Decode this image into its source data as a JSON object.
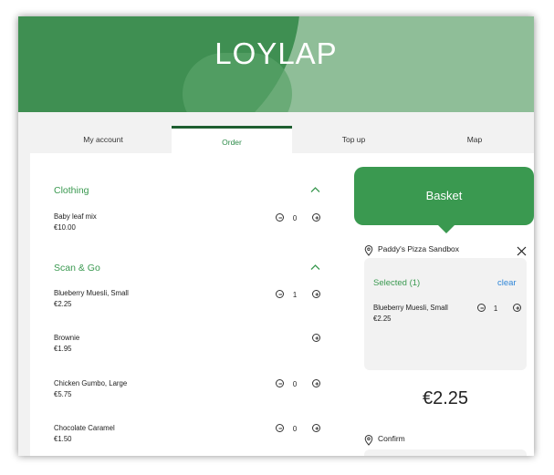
{
  "brand": {
    "title": "LOYLAP"
  },
  "tabs": [
    {
      "label": "My account"
    },
    {
      "label": "Order"
    },
    {
      "label": "Top up"
    },
    {
      "label": "Map"
    }
  ],
  "menu": {
    "categories": [
      {
        "title": "Clothing",
        "items": [
          {
            "name": "Baby leaf mix",
            "price": "€10.00",
            "qty": "0"
          }
        ]
      },
      {
        "title": "Scan & Go",
        "items": [
          {
            "name": "Blueberry Muesli, Small",
            "price": "€2.25",
            "qty": "1"
          },
          {
            "name": "Brownie",
            "price": "€1.95",
            "qty": ""
          },
          {
            "name": "Chicken Gumbo, Large",
            "price": "€5.75",
            "qty": "0"
          },
          {
            "name": "Chocolate Caramel",
            "price": "€1.50",
            "qty": "0"
          }
        ]
      }
    ]
  },
  "basket": {
    "title": "Basket",
    "store": "Paddy's Pizza Sandbox",
    "selected_label": "Selected (1)",
    "clear_label": "clear",
    "items": [
      {
        "name": "Blueberry Muesli, Small",
        "price": "€2.25",
        "qty": "1"
      }
    ],
    "total": "€2.25",
    "confirm_label": "Confirm"
  },
  "colors": {
    "accent": "#3a9950",
    "link": "#2f86d8",
    "tab_indicator": "#1e5e30"
  }
}
